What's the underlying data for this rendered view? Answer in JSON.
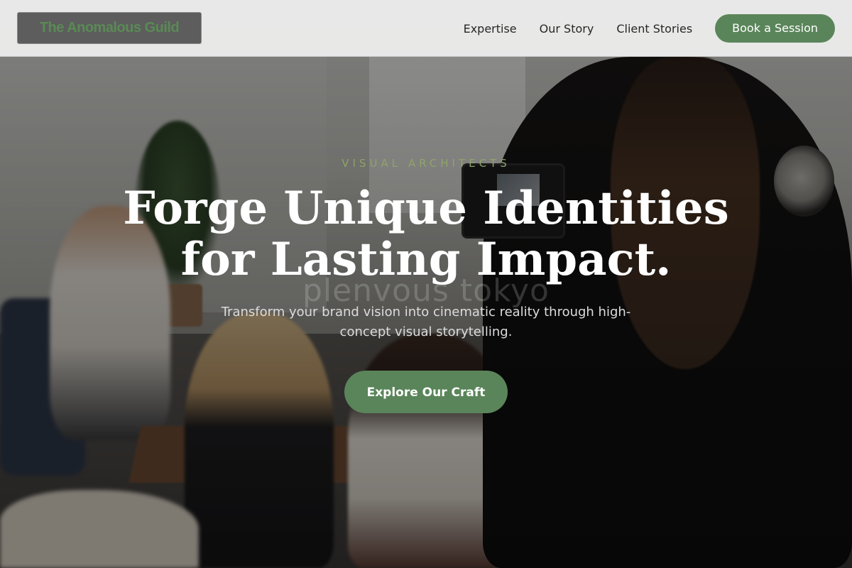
{
  "header": {
    "logo_text": "The Anomalous Guild",
    "nav": {
      "expertise": "Expertise",
      "our_story": "Our Story",
      "client_stories": "Client Stories"
    },
    "cta_label": "Book a Session"
  },
  "hero": {
    "eyebrow": "VISUAL ARCHITECTS",
    "title_line1": "Forge Unique Identities",
    "title_line2": "for Lasting Impact.",
    "subtitle": "Transform your brand vision into cinematic reality through high-concept visual storytelling.",
    "cta_label": "Explore Our Craft",
    "background_watermark": "plenvous tokyo"
  },
  "colors": {
    "accent_green": "#5a855a",
    "eyebrow_green": "#8fa36a",
    "header_bg": "#f0f0f0"
  }
}
